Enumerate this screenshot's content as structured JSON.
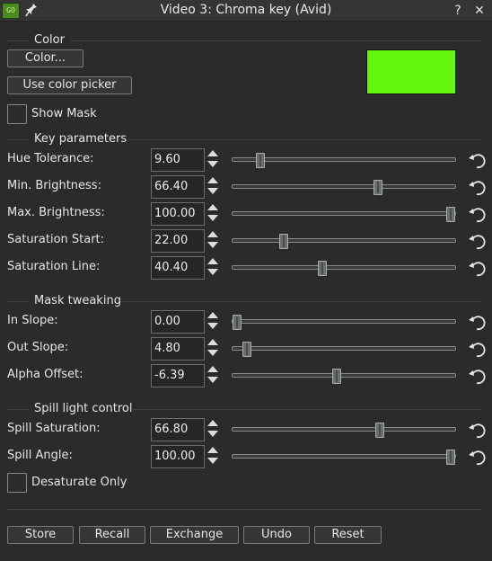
{
  "window": {
    "title": "Video 3: Chroma key (Avid)",
    "app_icon_text": "GO",
    "help_label": "?",
    "close_label": "✕"
  },
  "color_section": {
    "label": "Color",
    "color_button": "Color...",
    "picker_button": "Use color picker",
    "swatch_color": "#63f80b",
    "show_mask_label": "Show Mask",
    "show_mask_checked": false
  },
  "key_parameters": {
    "label": "Key parameters",
    "params": [
      {
        "label": "Hue Tolerance:",
        "value": "9.60",
        "fraction": 0.11
      },
      {
        "label": "Min. Brightness:",
        "value": "66.40",
        "fraction": 0.66
      },
      {
        "label": "Max. Brightness:",
        "value": "100.00",
        "fraction": 1.0
      },
      {
        "label": "Saturation Start:",
        "value": "22.00",
        "fraction": 0.22
      },
      {
        "label": "Saturation Line:",
        "value": "40.40",
        "fraction": 0.4
      }
    ]
  },
  "mask_tweaking": {
    "label": "Mask tweaking",
    "params": [
      {
        "label": "In Slope:",
        "value": "0.00",
        "fraction": 0.0
      },
      {
        "label": "Out Slope:",
        "value": "4.80",
        "fraction": 0.048
      },
      {
        "label": "Alpha Offset:",
        "value": "-6.39",
        "fraction": 0.468
      }
    ]
  },
  "spill_light_control": {
    "label": "Spill light control",
    "params": [
      {
        "label": "Spill Saturation:",
        "value": "66.80",
        "fraction": 0.668
      },
      {
        "label": "Spill Angle:",
        "value": "100.00",
        "fraction": 1.0
      }
    ],
    "desaturate_label": "Desaturate Only",
    "desaturate_checked": false
  },
  "footer_buttons": {
    "store": "Store",
    "recall": "Recall",
    "exchange": "Exchange",
    "undo": "Undo",
    "reset": "Reset"
  },
  "icons": {
    "pin": "pin-icon",
    "reset": "undo-arrow-icon",
    "spin_arrows": "up-down-arrows-icon"
  }
}
